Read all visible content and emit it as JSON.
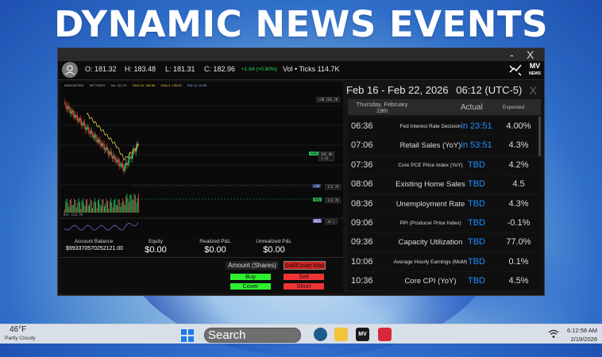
{
  "headline": "DYNAMIC NEWS EVENTS",
  "window": {
    "minimize": "-",
    "close": "X"
  },
  "quote": {
    "open": "O: 181.32",
    "high": "H: 183.48",
    "low": "L: 181.31",
    "close": "C: 182.96",
    "change": "+1.64 (+0.90%)",
    "vol": "Vol • Ticks 114.7K"
  },
  "brand": {
    "line1": "MV",
    "line2": "NEWS"
  },
  "chart": {
    "tabs": [
      "INDICATORS",
      "SETTINGS"
    ],
    "legend": [
      "Vol: 114.7K",
      "SMA 20: 186.88",
      "EMA 9: 185.50",
      "RSI 14: 34.85"
    ],
    "tags": {
      "high": "186.28",
      "price_title": "AAPL",
      "price": "182.96",
      "price_sub": "3:41",
      "low": "174.79",
      "vol": "114.7K",
      "rsi": "34.1",
      "vol_label": "VOL",
      "low_label": "LOW",
      "vol_axis": "VOL",
      "rsi_label": "RSI",
      "vol_pane": "Vol 114.7K"
    },
    "colors": {
      "up": "#26c260",
      "down": "#e03a3a",
      "sma": "#e5c84a",
      "rsi": "#8a6cd0"
    }
  },
  "account": {
    "balance_label": "Account Balance",
    "balance_value": "$993370570252121.00",
    "equity_label": "Equity",
    "equity_value": "$0.00",
    "realized_label": "Realized P&L",
    "realized_value": "$0.00",
    "unrealized_label": "Unrealized P&L",
    "unrealized_value": "$0.00"
  },
  "orders": {
    "amount_label": "Amount (Shares)",
    "sell_cover_max": "Sell/Cover Max",
    "buy": "Buy",
    "sell": "Sell",
    "cover": "Cover",
    "short": "Short"
  },
  "calendar": {
    "range": "Feb 16 - Feb 22, 2026",
    "time": "06:12 (UTC-5)",
    "close": "X",
    "day": "Thursday, February 19th",
    "col_actual": "Actual",
    "col_expected": "Expected",
    "events": [
      {
        "time": "06:36",
        "name": "Fed Interest Rate Decision",
        "actual": "in 23:51",
        "expected": "4.00%",
        "small": true
      },
      {
        "time": "07:06",
        "name": "Retail Sales (YoY)",
        "actual": "in 53:51",
        "expected": "4.3%",
        "small": false
      },
      {
        "time": "07:36",
        "name": "Core PCE Price Index (YoY)",
        "actual": "TBD",
        "expected": "4.2%",
        "small": true
      },
      {
        "time": "08:06",
        "name": "Existing Home Sales",
        "actual": "TBD",
        "expected": "4.5",
        "small": false
      },
      {
        "time": "08:36",
        "name": "Unemployment Rate",
        "actual": "TBD",
        "expected": "4.3%",
        "small": false
      },
      {
        "time": "09:06",
        "name": "PPI (Producer Price Index)",
        "actual": "TBD",
        "expected": "-0.1%",
        "small": true
      },
      {
        "time": "09:36",
        "name": "Capacity Utilization",
        "actual": "TBD",
        "expected": "77.0%",
        "small": false
      },
      {
        "time": "10:06",
        "name": "Average Hourly Earnings (MoM)",
        "actual": "TBD",
        "expected": "0.1%",
        "small": true
      },
      {
        "time": "10:36",
        "name": "Core CPI (YoY)",
        "actual": "TBD",
        "expected": "4.5%",
        "small": false
      }
    ]
  },
  "taskbar": {
    "temp": "46°F",
    "condition": "Partly Cloudy",
    "search_placeholder": "Search",
    "time": "6:12:58 AM",
    "date": "2/19/2026"
  }
}
